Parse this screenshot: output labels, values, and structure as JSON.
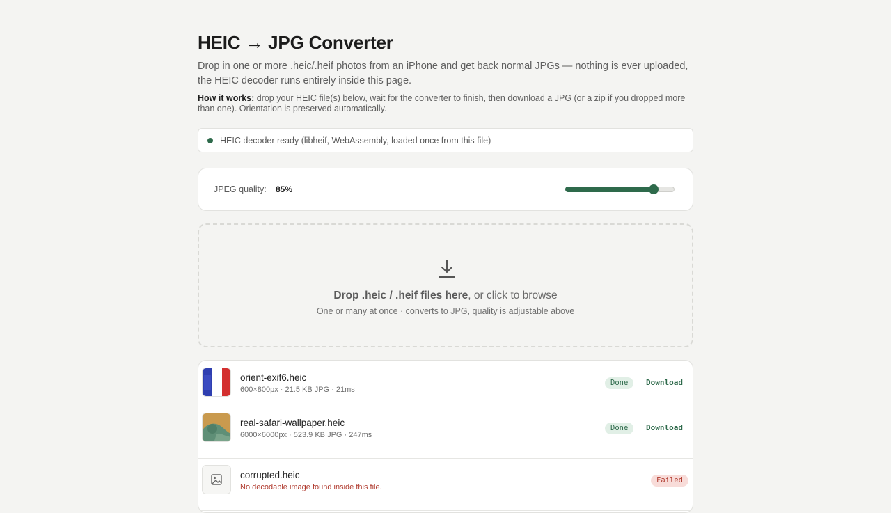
{
  "page": {
    "title": "HEIC → JPG Converter",
    "lede": "Drop in one or more .heic/.heif photos from an iPhone and get back normal JPGs — nothing is ever uploaded, the HEIC decoder runs entirely inside this page.",
    "how_label": "How it works:",
    "how_text": " drop your HEIC file(s) below, wait for the converter to finish, then download a JPG (or a zip if you dropped more than one). Orientation is preserved automatically."
  },
  "status": {
    "text": "HEIC decoder ready (libheif, WebAssembly, loaded once from this file)",
    "color": "#2e6a4b"
  },
  "quality": {
    "label": "JPEG quality:",
    "value_text": "85%",
    "value": 0.85
  },
  "dropzone": {
    "icon": "download-icon",
    "main_bold": "Drop .heic / .heif files here",
    "main_rest": ", or click to browse",
    "sub": "One or many at once · converts to JPG, quality is adjustable above"
  },
  "files": [
    {
      "name": "orient-exif6.heic",
      "meta": "600×800px · 21.5 KB JPG · 21ms",
      "status": "Done",
      "action": "Download",
      "thumb": "flag-thumbnail"
    },
    {
      "name": "real-safari-wallpaper.heic",
      "meta": "6000×6000px · 523.9 KB JPG · 247ms",
      "status": "Done",
      "action": "Download",
      "thumb": "wallpaper-thumbnail"
    },
    {
      "name": "corrupted.heic",
      "meta": "No decodable image found inside this file.",
      "status": "Failed",
      "thumb": "image-placeholder-icon"
    }
  ],
  "colors": {
    "accent": "#2e6a4b",
    "error": "#b03a2e",
    "background": "#f4f4f2"
  }
}
